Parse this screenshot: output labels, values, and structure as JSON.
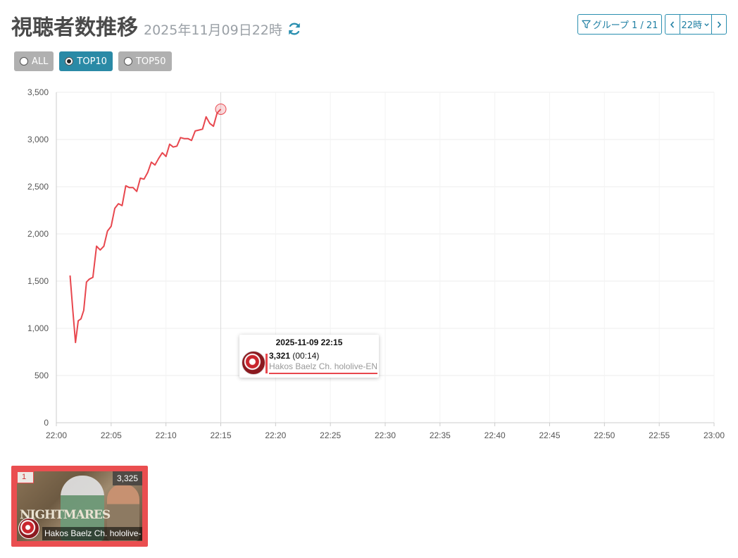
{
  "header": {
    "title": "視聴者数推移",
    "date": "2025年11月09日22時"
  },
  "controls": {
    "group_label": "グループ 1 / 21",
    "hour_label": "22時"
  },
  "filters": [
    {
      "label": "ALL",
      "selected": false
    },
    {
      "label": "TOP10",
      "selected": true
    },
    {
      "label": "TOP50",
      "selected": false
    }
  ],
  "colors": {
    "accent": "#2a8aa6",
    "line": "#e8474e",
    "inactive_filter": "#b0b0b0"
  },
  "icons": [
    "refresh-icon",
    "filter-icon",
    "chevron-left-icon",
    "chevron-right-icon",
    "chevron-down-icon"
  ],
  "chart_data": {
    "type": "line",
    "title": "",
    "xlabel": "",
    "ylabel": "",
    "ylim": [
      0,
      3500
    ],
    "xlim": [
      "22:00",
      "23:00"
    ],
    "y_ticks": [
      "0",
      "500",
      "1,000",
      "1,500",
      "2,000",
      "2,500",
      "3,000",
      "3,500"
    ],
    "x_ticks": [
      "22:00",
      "22:05",
      "22:10",
      "22:15",
      "22:20",
      "22:25",
      "22:30",
      "22:35",
      "22:40",
      "22:45",
      "22:50",
      "22:55",
      "23:00"
    ],
    "grid": true,
    "series": [
      {
        "name": "Hakos Baelz Ch. hololive-EN",
        "x": [
          "22:01:15",
          "22:01:30",
          "22:01:45",
          "22:02:00",
          "22:02:15",
          "22:02:30",
          "22:02:45",
          "22:03:00",
          "22:03:20",
          "22:03:40",
          "22:04:00",
          "22:04:20",
          "22:04:40",
          "22:05:00",
          "22:05:20",
          "22:05:40",
          "22:06:00",
          "22:06:20",
          "22:06:40",
          "22:07:00",
          "22:07:20",
          "22:07:40",
          "22:08:00",
          "22:08:20",
          "22:08:40",
          "22:09:00",
          "22:09:20",
          "22:09:40",
          "22:10:00",
          "22:10:20",
          "22:10:40",
          "22:11:00",
          "22:11:20",
          "22:11:40",
          "22:12:00",
          "22:12:20",
          "22:12:40",
          "22:13:00",
          "22:13:20",
          "22:13:40",
          "22:14:00",
          "22:14:20",
          "22:14:40",
          "22:15:00"
        ],
        "values": [
          1560,
          1200,
          850,
          1080,
          1100,
          1190,
          1490,
          1520,
          1540,
          1870,
          1830,
          1870,
          2030,
          2080,
          2270,
          2320,
          2300,
          2510,
          2490,
          2490,
          2450,
          2590,
          2580,
          2650,
          2760,
          2730,
          2800,
          2860,
          2820,
          2950,
          2920,
          2930,
          3020,
          3010,
          3010,
          2990,
          3090,
          3100,
          3110,
          3240,
          3170,
          3140,
          3280,
          3321
        ]
      }
    ]
  },
  "tooltip": {
    "time": "2025-11-09 22:15",
    "value": "3,321",
    "duration": "(00:14)",
    "channel": "Hakos Baelz Ch. hololive-EN"
  },
  "cards": [
    {
      "rank": "1",
      "viewers": "3,325",
      "channel": "Hakos Baelz Ch. hololive-",
      "thumb_text": "NIGHTMARES"
    }
  ]
}
